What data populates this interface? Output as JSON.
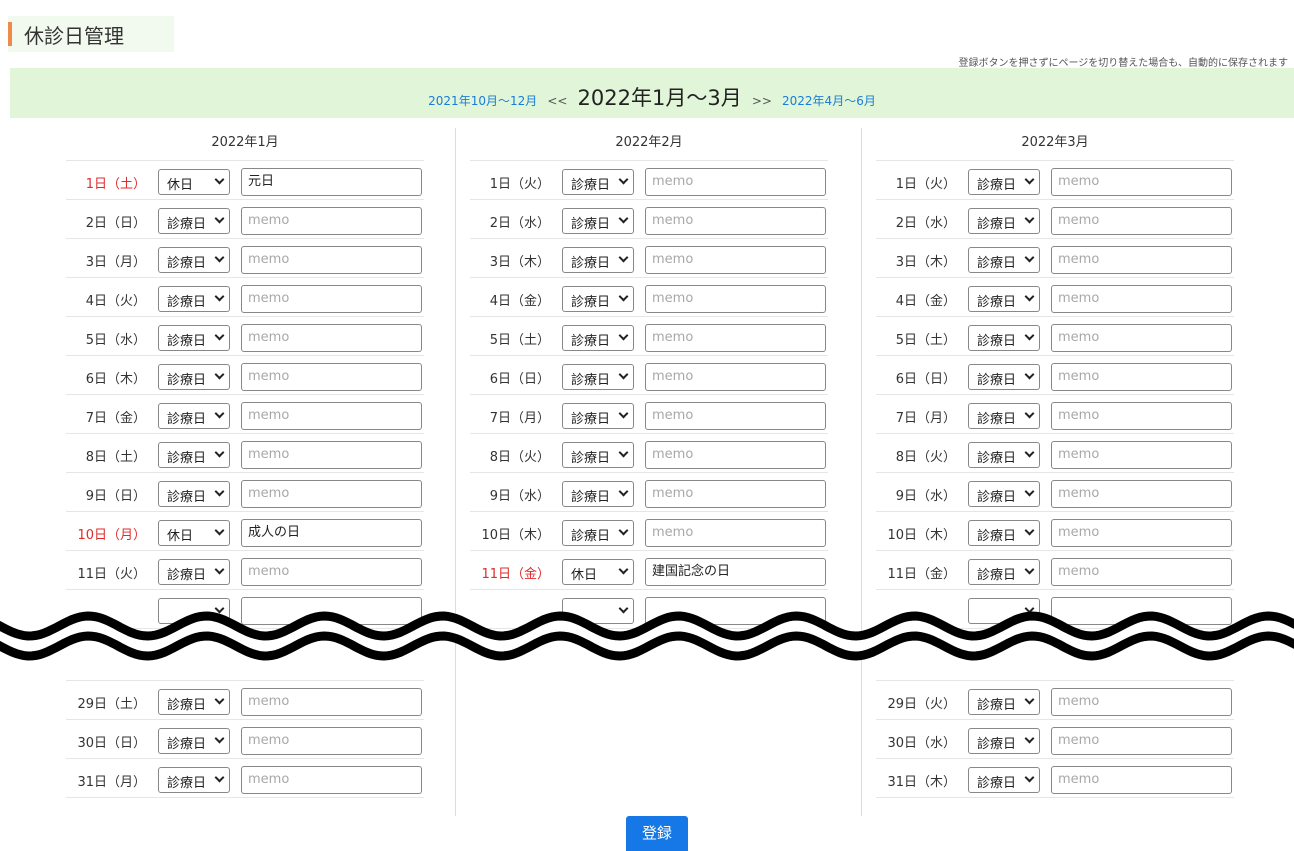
{
  "page": {
    "title": "休診日管理",
    "note": "登録ボタンを押さずにページを切り替えた場合も、自動的に保存されます",
    "submit_label": "登録"
  },
  "nav": {
    "prev_label": "2021年10月～12月",
    "prev_arrow": "<<",
    "current_label": "2022年1月～3月",
    "next_arrow": ">>",
    "next_label": "2022年4月～6月"
  },
  "placeholder": "memo",
  "colors": {
    "accent": "#f08a4b",
    "nav_bg": "#e1f5d8",
    "link": "#1a7dd8",
    "holiday": "#e02b2b",
    "button": "#1677e6"
  },
  "months": [
    {
      "title": "2022年1月",
      "days": [
        {
          "label": "1日（土）",
          "type": "休日",
          "memo": "元日",
          "holiday": true
        },
        {
          "label": "2日（日）",
          "type": "診療日",
          "memo": "",
          "holiday": false
        },
        {
          "label": "3日（月）",
          "type": "診療日",
          "memo": "",
          "holiday": false
        },
        {
          "label": "4日（火）",
          "type": "診療日",
          "memo": "",
          "holiday": false
        },
        {
          "label": "5日（水）",
          "type": "診療日",
          "memo": "",
          "holiday": false
        },
        {
          "label": "6日（木）",
          "type": "診療日",
          "memo": "",
          "holiday": false
        },
        {
          "label": "7日（金）",
          "type": "診療日",
          "memo": "",
          "holiday": false
        },
        {
          "label": "8日（土）",
          "type": "診療日",
          "memo": "",
          "holiday": false
        },
        {
          "label": "9日（日）",
          "type": "診療日",
          "memo": "",
          "holiday": false
        },
        {
          "label": "10日（月）",
          "type": "休日",
          "memo": "成人の日",
          "holiday": true
        },
        {
          "label": "11日（火）",
          "type": "診療日",
          "memo": "",
          "holiday": false
        }
      ],
      "tail": [
        {
          "label": "29日（土）",
          "type": "診療日",
          "memo": "",
          "holiday": false
        },
        {
          "label": "30日（日）",
          "type": "診療日",
          "memo": "",
          "holiday": false
        },
        {
          "label": "31日（月）",
          "type": "診療日",
          "memo": "",
          "holiday": false
        }
      ]
    },
    {
      "title": "2022年2月",
      "days": [
        {
          "label": "1日（火）",
          "type": "診療日",
          "memo": "",
          "holiday": false
        },
        {
          "label": "2日（水）",
          "type": "診療日",
          "memo": "",
          "holiday": false
        },
        {
          "label": "3日（木）",
          "type": "診療日",
          "memo": "",
          "holiday": false
        },
        {
          "label": "4日（金）",
          "type": "診療日",
          "memo": "",
          "holiday": false
        },
        {
          "label": "5日（土）",
          "type": "診療日",
          "memo": "",
          "holiday": false
        },
        {
          "label": "6日（日）",
          "type": "診療日",
          "memo": "",
          "holiday": false
        },
        {
          "label": "7日（月）",
          "type": "診療日",
          "memo": "",
          "holiday": false
        },
        {
          "label": "8日（火）",
          "type": "診療日",
          "memo": "",
          "holiday": false
        },
        {
          "label": "9日（水）",
          "type": "診療日",
          "memo": "",
          "holiday": false
        },
        {
          "label": "10日（木）",
          "type": "診療日",
          "memo": "",
          "holiday": false
        },
        {
          "label": "11日（金）",
          "type": "休日",
          "memo": "建国記念の日",
          "holiday": true
        }
      ],
      "tail": []
    },
    {
      "title": "2022年3月",
      "days": [
        {
          "label": "1日（火）",
          "type": "診療日",
          "memo": "",
          "holiday": false
        },
        {
          "label": "2日（水）",
          "type": "診療日",
          "memo": "",
          "holiday": false
        },
        {
          "label": "3日（木）",
          "type": "診療日",
          "memo": "",
          "holiday": false
        },
        {
          "label": "4日（金）",
          "type": "診療日",
          "memo": "",
          "holiday": false
        },
        {
          "label": "5日（土）",
          "type": "診療日",
          "memo": "",
          "holiday": false
        },
        {
          "label": "6日（日）",
          "type": "診療日",
          "memo": "",
          "holiday": false
        },
        {
          "label": "7日（月）",
          "type": "診療日",
          "memo": "",
          "holiday": false
        },
        {
          "label": "8日（火）",
          "type": "診療日",
          "memo": "",
          "holiday": false
        },
        {
          "label": "9日（水）",
          "type": "診療日",
          "memo": "",
          "holiday": false
        },
        {
          "label": "10日（木）",
          "type": "診療日",
          "memo": "",
          "holiday": false
        },
        {
          "label": "11日（金）",
          "type": "診療日",
          "memo": "",
          "holiday": false
        }
      ],
      "tail": [
        {
          "label": "29日（火）",
          "type": "診療日",
          "memo": "",
          "holiday": false
        },
        {
          "label": "30日（水）",
          "type": "診療日",
          "memo": "",
          "holiday": false
        },
        {
          "label": "31日（木）",
          "type": "診療日",
          "memo": "",
          "holiday": false
        }
      ]
    }
  ]
}
